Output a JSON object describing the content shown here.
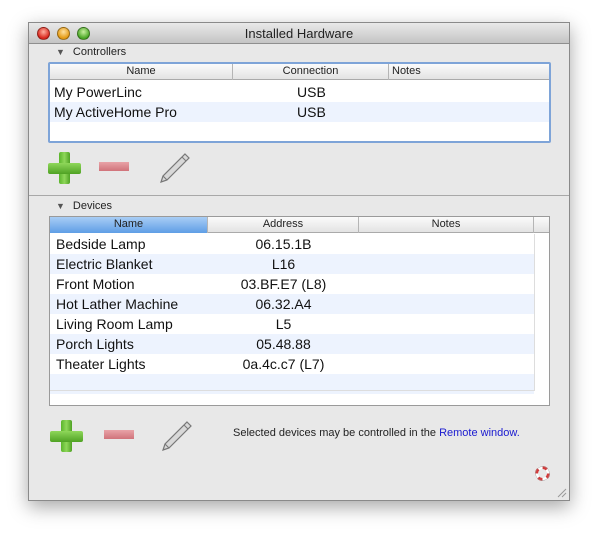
{
  "window": {
    "title": "Installed Hardware"
  },
  "controllers": {
    "section_label": "Controllers",
    "columns": [
      "Name",
      "Connection",
      "Notes"
    ],
    "rows": [
      {
        "name": "My PowerLinc",
        "connection": "USB",
        "notes": ""
      },
      {
        "name": "My ActiveHome Pro",
        "connection": "USB",
        "notes": ""
      }
    ]
  },
  "devices": {
    "section_label": "Devices",
    "columns": [
      "Name",
      "Address",
      "Notes"
    ],
    "rows": [
      {
        "name": "Bedside Lamp",
        "address": "06.15.1B",
        "notes": ""
      },
      {
        "name": "Electric Blanket",
        "address": "L16",
        "notes": ""
      },
      {
        "name": "Front Motion",
        "address": "03.BF.E7 (L8)",
        "notes": ""
      },
      {
        "name": "Hot Lather Machine",
        "address": "06.32.A4",
        "notes": ""
      },
      {
        "name": "Living Room Lamp",
        "address": "L5",
        "notes": ""
      },
      {
        "name": "Porch Lights",
        "address": "05.48.88",
        "notes": ""
      },
      {
        "name": "Theater Lights",
        "address": "0a.4c.c7 (L7)",
        "notes": ""
      }
    ]
  },
  "footer": {
    "info_text": "Selected devices may be controlled in the",
    "link_text": "Remote window."
  },
  "icons": {
    "add": "plus-icon",
    "remove": "minus-icon",
    "edit": "pencil-icon",
    "help": "lifebuoy-icon"
  }
}
